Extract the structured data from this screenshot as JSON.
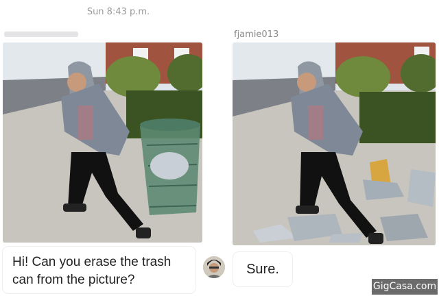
{
  "conversation": {
    "timestamp": "Sun 8:43 p.m.",
    "reply_sender": "fjamie013",
    "messages": [
      {
        "from": "user",
        "text": "Hi! Can you erase the trash can from the picture?"
      },
      {
        "from": "fjamie013",
        "text": "Sure."
      }
    ]
  },
  "watermark": "GigCasa.com",
  "colors": {
    "bubble_bg": "#ffffff",
    "meta_text": "#9a9a9a",
    "watermark_bg": "#6b6b6b"
  }
}
